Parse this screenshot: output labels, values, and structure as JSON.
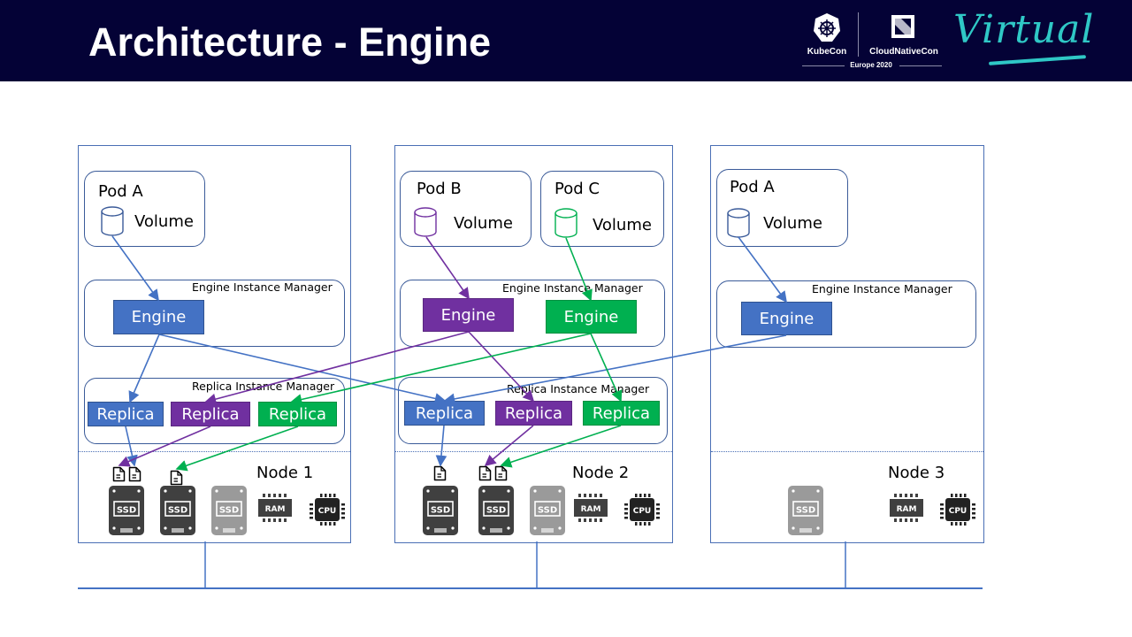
{
  "header": {
    "title": "Architecture - Engine",
    "logo": {
      "kubecon": "KubeCon",
      "cloudnativecon": "CloudNativeCon",
      "event": "Europe 2020",
      "virtual": "Virtual"
    },
    "colors": {
      "background": "#040236",
      "accent": "#2fc8c6"
    }
  },
  "colors": {
    "blue": "#4472c4",
    "purple": "#7030a0",
    "green": "#00b050",
    "border": "#4a6fb5"
  },
  "nodes": [
    {
      "label": "Node 1",
      "pods": [
        {
          "name": "Pod A",
          "volume": "Volume",
          "color": "blue"
        }
      ],
      "engine_manager": "Engine Instance Manager",
      "engines": [
        {
          "label": "Engine",
          "color": "blue"
        }
      ],
      "replica_manager": "Replica Instance Manager",
      "replicas": [
        {
          "label": "Replica",
          "color": "blue"
        },
        {
          "label": "Replica",
          "color": "purple"
        },
        {
          "label": "Replica",
          "color": "green"
        }
      ],
      "hardware": [
        {
          "type": "ssd",
          "label": "SSD",
          "used": true,
          "files": 2
        },
        {
          "type": "ssd",
          "label": "SSD",
          "used": true,
          "files": 1
        },
        {
          "type": "ssd",
          "label": "SSD",
          "used": false,
          "files": 0
        },
        {
          "type": "ram",
          "label": "RAM"
        },
        {
          "type": "cpu",
          "label": "CPU"
        }
      ]
    },
    {
      "label": "Node 2",
      "pods": [
        {
          "name": "Pod B",
          "volume": "Volume",
          "color": "purple"
        },
        {
          "name": "Pod C",
          "volume": "Volume",
          "color": "green"
        }
      ],
      "engine_manager": "Engine Instance Manager",
      "engines": [
        {
          "label": "Engine",
          "color": "purple"
        },
        {
          "label": "Engine",
          "color": "green"
        }
      ],
      "replica_manager": "Replica Instance Manager",
      "replicas": [
        {
          "label": "Replica",
          "color": "blue"
        },
        {
          "label": "Replica",
          "color": "purple"
        },
        {
          "label": "Replica",
          "color": "green"
        }
      ],
      "hardware": [
        {
          "type": "ssd",
          "label": "SSD",
          "used": true,
          "files": 1
        },
        {
          "type": "ssd",
          "label": "SSD",
          "used": true,
          "files": 2
        },
        {
          "type": "ssd",
          "label": "SSD",
          "used": false,
          "files": 0
        },
        {
          "type": "ram",
          "label": "RAM"
        },
        {
          "type": "cpu",
          "label": "CPU"
        }
      ]
    },
    {
      "label": "Node 3",
      "pods": [
        {
          "name": "Pod A",
          "volume": "Volume",
          "color": "blue"
        }
      ],
      "engine_manager": "Engine Instance Manager",
      "engines": [
        {
          "label": "Engine",
          "color": "blue"
        }
      ],
      "hardware": [
        {
          "type": "ssd",
          "label": "SSD",
          "used": false,
          "files": 0
        },
        {
          "type": "ram",
          "label": "RAM"
        },
        {
          "type": "cpu",
          "label": "CPU"
        }
      ]
    }
  ],
  "connections": [
    {
      "from": "node1.pod-a.volume",
      "to": "node1.engine",
      "color": "blue"
    },
    {
      "from": "node1.engine",
      "to": "node1.replica-blue",
      "color": "blue"
    },
    {
      "from": "node1.engine",
      "to": "node2.replica-blue",
      "color": "blue"
    },
    {
      "from": "node3.pod-a.volume",
      "to": "node3.engine",
      "color": "blue"
    },
    {
      "from": "node3.engine",
      "to": "node2.replica-blue",
      "color": "blue"
    },
    {
      "from": "node2.pod-b.volume",
      "to": "node2.engine-purple",
      "color": "purple"
    },
    {
      "from": "node2.engine-purple",
      "to": "node1.replica-purple",
      "color": "purple"
    },
    {
      "from": "node2.engine-purple",
      "to": "node2.replica-purple",
      "color": "purple"
    },
    {
      "from": "node2.pod-c.volume",
      "to": "node2.engine-green",
      "color": "green"
    },
    {
      "from": "node2.engine-green",
      "to": "node1.replica-green",
      "color": "green"
    },
    {
      "from": "node2.engine-green",
      "to": "node2.replica-green",
      "color": "green"
    },
    {
      "from": "node1.replica-blue",
      "to": "node1.ssd1.file2",
      "color": "blue"
    },
    {
      "from": "node1.replica-purple",
      "to": "node1.ssd1.file1",
      "color": "purple"
    },
    {
      "from": "node1.replica-green",
      "to": "node1.ssd2.file1",
      "color": "green"
    },
    {
      "from": "node2.replica-blue",
      "to": "node2.ssd1.file1",
      "color": "blue"
    },
    {
      "from": "node2.replica-purple",
      "to": "node2.ssd2.file1",
      "color": "purple"
    },
    {
      "from": "node2.replica-green",
      "to": "node2.ssd2.file2",
      "color": "green"
    }
  ]
}
